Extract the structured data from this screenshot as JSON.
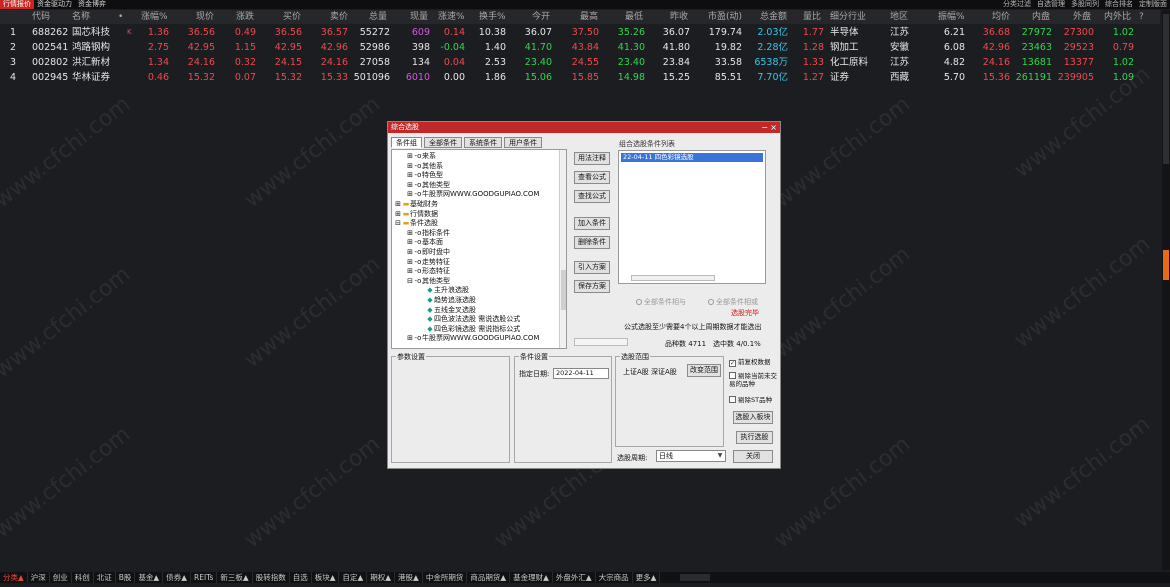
{
  "top_tabs": [
    "行情报价",
    "资金驱动力",
    "资金博弈"
  ],
  "top_right": [
    "分类过滤",
    "自选管理",
    "多股同列",
    "综合排名",
    "定制版面"
  ],
  "columns": [
    "代码",
    "名称",
    "•",
    "涨幅%",
    "现价",
    "涨跌",
    "买价",
    "卖价",
    "总量",
    "现量",
    "涨速%",
    "换手%",
    "今开",
    "最高",
    "最低",
    "昨收",
    "市盈(动)",
    "总金额",
    "量比",
    "细分行业",
    "地区",
    "振幅%",
    "均价",
    "内盘",
    "外盘",
    "内外比",
    "?"
  ],
  "rows": [
    {
      "idx": "1",
      "code": "688262",
      "name": "国芯科技",
      "flag": "K",
      "chg_pct": "1.36",
      "price": "36.56",
      "chg": "0.49",
      "bid": "36.56",
      "ask": "36.57",
      "vol": "55272",
      "cur_vol": "609",
      "speed": "0.14",
      "turnover": "10.38",
      "open": "36.07",
      "high": "37.50",
      "low": "35.26",
      "prev": "36.07",
      "pe": "179.74",
      "amount": "2.03亿",
      "vol_ratio": "1.77",
      "industry": "半导体",
      "region": "江苏",
      "amplitude": "6.21",
      "avg": "36.68",
      "inner": "27972",
      "outer": "27300",
      "io_ratio": "1.02"
    },
    {
      "idx": "2",
      "code": "002541",
      "name": "鸿路钢构",
      "flag": "",
      "chg_pct": "2.75",
      "price": "42.95",
      "chg": "1.15",
      "bid": "42.95",
      "ask": "42.96",
      "vol": "52986",
      "cur_vol": "398",
      "speed": "-0.04",
      "turnover": "1.40",
      "open": "41.70",
      "high": "43.84",
      "low": "41.30",
      "prev": "41.80",
      "pe": "19.82",
      "amount": "2.28亿",
      "vol_ratio": "1.28",
      "industry": "钢加工",
      "region": "安徽",
      "amplitude": "6.08",
      "avg": "42.96",
      "inner": "23463",
      "outer": "29523",
      "io_ratio": "0.79"
    },
    {
      "idx": "3",
      "code": "002802",
      "name": "洪汇新材",
      "flag": "",
      "chg_pct": "1.34",
      "price": "24.16",
      "chg": "0.32",
      "bid": "24.15",
      "ask": "24.16",
      "vol": "27058",
      "cur_vol": "134",
      "speed": "0.04",
      "turnover": "2.53",
      "open": "23.40",
      "high": "24.55",
      "low": "23.40",
      "prev": "23.84",
      "pe": "33.58",
      "amount": "6538万",
      "vol_ratio": "1.33",
      "industry": "化工原料",
      "region": "江苏",
      "amplitude": "4.82",
      "avg": "24.16",
      "inner": "13681",
      "outer": "13377",
      "io_ratio": "1.02"
    },
    {
      "idx": "4",
      "code": "002945",
      "name": "华林证券",
      "flag": "",
      "chg_pct": "0.46",
      "price": "15.32",
      "chg": "0.07",
      "bid": "15.32",
      "ask": "15.33",
      "vol": "501096",
      "cur_vol": "6010",
      "speed": "0.00",
      "turnover": "1.86",
      "open": "15.06",
      "high": "15.85",
      "low": "14.98",
      "prev": "15.25",
      "pe": "85.51",
      "amount": "7.70亿",
      "vol_ratio": "1.27",
      "industry": "证券",
      "region": "西藏",
      "amplitude": "5.70",
      "avg": "15.36",
      "inner": "261191",
      "outer": "239905",
      "io_ratio": "1.09"
    }
  ],
  "watermark": "www.cfchi.com",
  "bottom_tabs": [
    "分类▲",
    "沪深",
    "创业",
    "科创",
    "北证",
    "B股",
    "基金▲",
    "债券▲",
    "REITs",
    "新三板▲",
    "股转指数",
    "自选",
    "板块▲",
    "自定▲",
    "期权▲",
    "港股▲",
    "中金所期货",
    "商品期货▲",
    "基金理财▲",
    "外盘外汇▲",
    "大宗商品",
    "更多▲"
  ],
  "dialog": {
    "title": "综合选股",
    "tabs": [
      "条件组",
      "全部条件",
      "系统条件",
      "用户条件"
    ],
    "tree": [
      {
        "indent": 2,
        "prefix": "⊞",
        "icon": "-o",
        "label": "来系"
      },
      {
        "indent": 2,
        "prefix": "⊞",
        "icon": "-o",
        "label": "其他系"
      },
      {
        "indent": 2,
        "prefix": "⊞",
        "icon": "-o",
        "label": "特色型"
      },
      {
        "indent": 2,
        "prefix": "⊞",
        "icon": "-o",
        "label": "其他类型"
      },
      {
        "indent": 2,
        "prefix": "⊞",
        "icon": "-o",
        "label": "牛股票网WWW.GOODGUPIAO.COM"
      },
      {
        "indent": 0,
        "prefix": "⊞",
        "icon": "▬",
        "label": "基础财务"
      },
      {
        "indent": 0,
        "prefix": "⊞",
        "icon": "▬",
        "label": "行情数据"
      },
      {
        "indent": 0,
        "prefix": "⊟",
        "icon": "▬",
        "label": "条件选股"
      },
      {
        "indent": 2,
        "prefix": "⊞",
        "icon": "-o",
        "label": "指标条件"
      },
      {
        "indent": 2,
        "prefix": "⊞",
        "icon": "-o",
        "label": "基本面"
      },
      {
        "indent": 2,
        "prefix": "⊞",
        "icon": "-o",
        "label": "即时盘中"
      },
      {
        "indent": 2,
        "prefix": "⊞",
        "icon": "-o",
        "label": "走势特征"
      },
      {
        "indent": 2,
        "prefix": "⊞",
        "icon": "-o",
        "label": "形态特征"
      },
      {
        "indent": 2,
        "prefix": "⊟",
        "icon": "-o",
        "label": "其他类型"
      },
      {
        "indent": 4,
        "prefix": "",
        "icon": "◆",
        "label": "主升浪选股"
      },
      {
        "indent": 4,
        "prefix": "",
        "icon": "◆",
        "label": "趋势追涨选股"
      },
      {
        "indent": 4,
        "prefix": "",
        "icon": "◆",
        "label": "五线金叉选股"
      },
      {
        "indent": 4,
        "prefix": "",
        "icon": "◆",
        "label": "四色波法选股 需说选股公式"
      },
      {
        "indent": 4,
        "prefix": "",
        "icon": "◆",
        "label": "四色彩镜选股 需说指标公式"
      },
      {
        "indent": 2,
        "prefix": "⊞",
        "icon": "-o",
        "label": "牛股票网WWW.GOODGUPIAO.COM"
      }
    ],
    "buttons_mid": [
      "用法注释",
      "查看公式",
      "查找公式",
      "加入条件",
      "删除条件",
      "引入方案",
      "保存方案"
    ],
    "list_label": "组合选股条件列表",
    "list_items": [
      "22-04-11 四色彩镜选股"
    ],
    "radio_and": "全部条件相与",
    "radio_or": "全部条件相或",
    "done_text": "选股完毕",
    "note": "公式选股至少需要4个以上周期数据才能选出",
    "stat_label": "品种数",
    "stat_value": "4711",
    "hit_label": "选中数",
    "hit_value": "4/0.1%",
    "params_label": "参数设置",
    "condset_label": "条件设置",
    "date_label": "指定日期:",
    "date_value": "2022-04-11",
    "range_label": "选股范围",
    "range_value": "上证A股  深证A股",
    "change_range": "改变范围",
    "chk_prefilter": "前复权数据",
    "chk_prefilter_checked": true,
    "chk_exclude_suspended": "剔除当前未交易的品种",
    "chk_exclude_st": "剔除ST品种",
    "btn_add_block": "选股入板块",
    "btn_run": "执行选股",
    "period_label": "选股周期:",
    "period_value": "日线",
    "btn_close": "关闭",
    "ctl_min": "−",
    "ctl_close": "×"
  }
}
